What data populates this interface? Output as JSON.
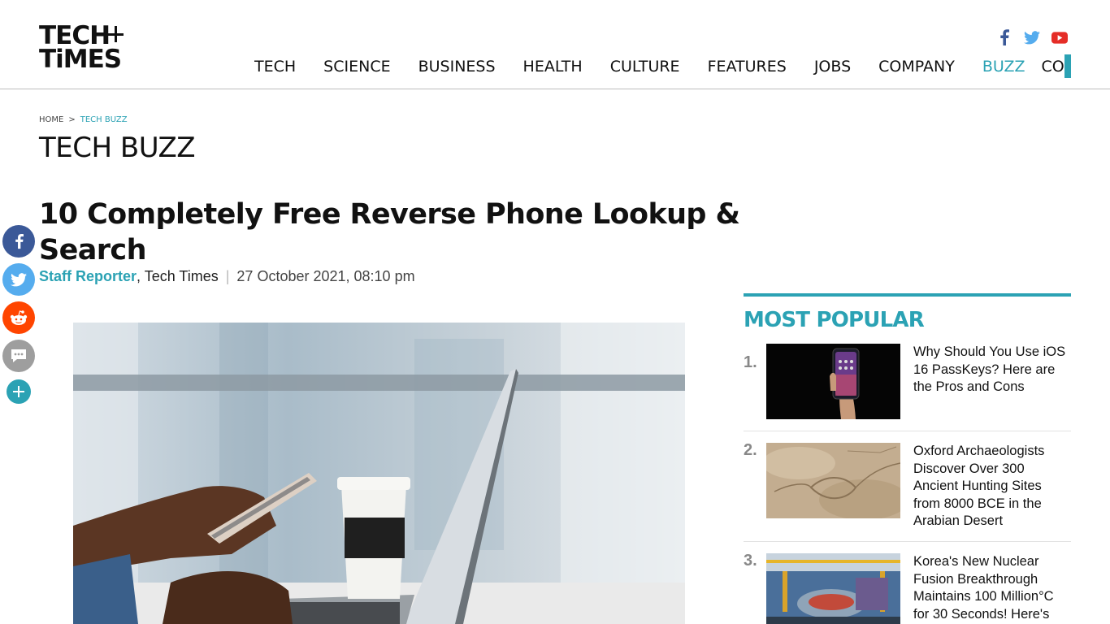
{
  "brand": {
    "logo_line1": "TECH",
    "logo_line2": "TiMES"
  },
  "social_top": [
    "facebook-icon",
    "twitter-icon",
    "youtube-icon"
  ],
  "nav": {
    "items": [
      "TECH",
      "SCIENCE",
      "BUSINESS",
      "HEALTH",
      "CULTURE",
      "FEATURES",
      "JOBS",
      "COMPANY",
      "BUZZ",
      "CO"
    ],
    "active": "BUZZ"
  },
  "share_bar": [
    "facebook-icon",
    "twitter-icon",
    "reddit-icon",
    "comment-icon",
    "plus-icon"
  ],
  "breadcrumb": {
    "home": "HOME",
    "separator": ">",
    "current": "TECH BUZZ"
  },
  "section_title": "TECH BUZZ",
  "article": {
    "headline": "10 Completely Free Reverse Phone Lookup & Search",
    "author": "Staff Reporter",
    "publication": ", Tech Times",
    "separator": "|",
    "date": "27 October 2021, 08:10 pm"
  },
  "most_popular": {
    "title": "MOST POPULAR",
    "items": [
      {
        "rank": "1.",
        "title": "Why Should You Use iOS 16 PassKeys? Here are the Pros and Cons"
      },
      {
        "rank": "2.",
        "title": "Oxford Archaeologists Discover Over 300 Ancient Hunting Sites from 8000 BCE in the Arabian Desert"
      },
      {
        "rank": "3.",
        "title": "Korea's New Nuclear Fusion Breakthrough Maintains 100 Million°C for 30 Seconds! Here's"
      }
    ]
  },
  "colors": {
    "accent": "#2ba2b4",
    "facebook": "#3b5998",
    "twitter": "#55acee",
    "reddit": "#ff4500",
    "youtube": "#e52d27"
  }
}
